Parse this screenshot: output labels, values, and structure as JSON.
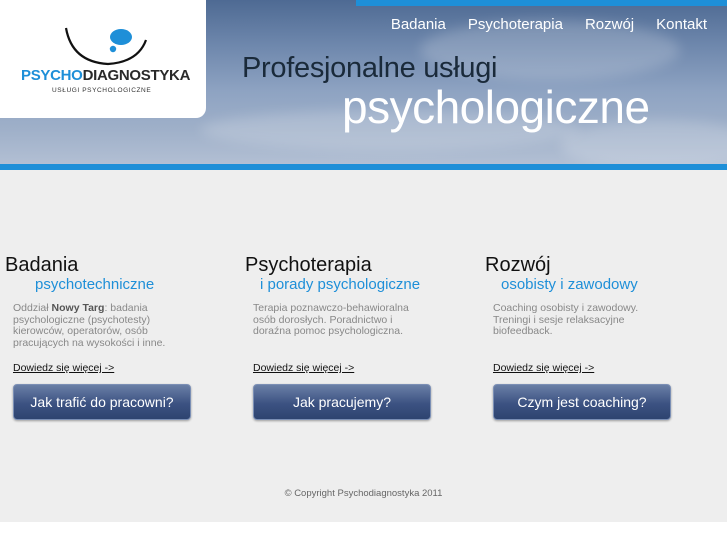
{
  "logo": {
    "part_blue": "PSYCHO",
    "part_dark": "DIAGNOSTYKA",
    "subtitle": "USŁUGI  PSYCHOLOGICZNE"
  },
  "nav": {
    "items": [
      "Badania",
      "Psychoterapia",
      "Rozwój",
      "Kontakt"
    ]
  },
  "hero": {
    "line1": "Profesjonalne usługi",
    "line2": "psychologiczne"
  },
  "columns": [
    {
      "title": "Badania",
      "subtitle": "psychotechniczne",
      "desc_pre": "Oddział ",
      "desc_bold": "Nowy Targ",
      "desc_post": ": badania psychologiczne (psychotesty) kierowców, operatorów, osób pracujących na wysokości i inne.",
      "more": "Dowiedz się więcej ->",
      "button": "Jak trafić do pracowni?"
    },
    {
      "title": "Psychoterapia",
      "subtitle": "i porady psychologiczne",
      "desc_pre": "Terapia poznawczo-behawioralna osób dorosłych. Poradnictwo i doraźna pomoc psychologiczna.",
      "desc_bold": "",
      "desc_post": "",
      "more": "Dowiedz się więcej ->",
      "button": "Jak pracujemy?"
    },
    {
      "title": "Rozwój",
      "subtitle": "osobisty i zawodowy",
      "desc_pre": "Coaching osobisty i zawodowy. Treningi i sesje relaksacyjne biofeedback.",
      "desc_bold": "",
      "desc_post": "",
      "more": "Dowiedz się więcej ->",
      "button": "Czym jest coaching?"
    }
  ],
  "footer": {
    "copyright": "© Copyright Psychodiagnostyka 2011"
  },
  "colors": {
    "accent": "#1e8fd8",
    "button": "#3c5282",
    "content_bg": "#eeeeee"
  }
}
